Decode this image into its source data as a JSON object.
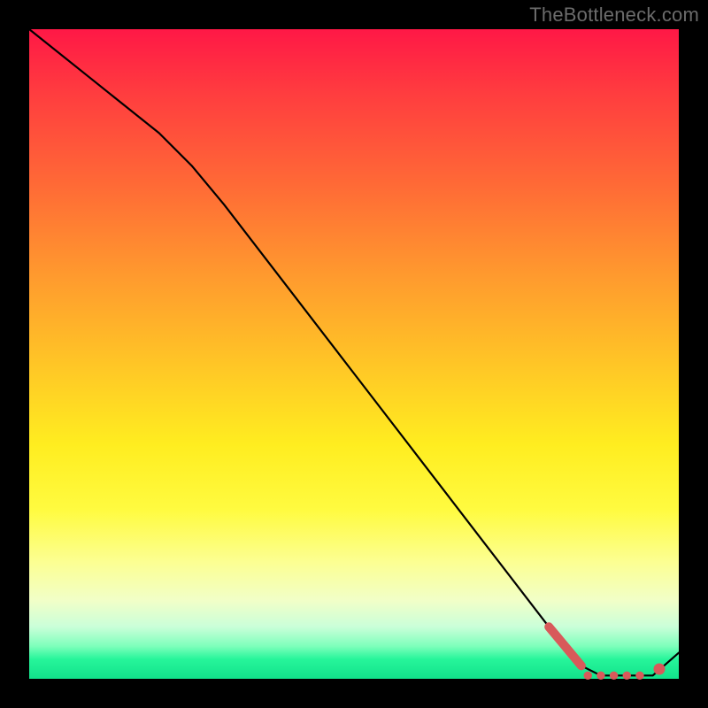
{
  "watermark": "TheBottleneck.com",
  "chart_data": {
    "type": "line",
    "title": "",
    "xlabel": "",
    "ylabel": "",
    "xlim": [
      0,
      100
    ],
    "ylim": [
      0,
      100
    ],
    "grid": false,
    "series": [
      {
        "name": "bottleneck-curve",
        "x": [
          0,
          10,
          20,
          25,
          30,
          40,
          50,
          60,
          70,
          80,
          85,
          88,
          92,
          96,
          100
        ],
        "y": [
          100,
          92,
          84,
          79,
          73,
          60,
          47,
          34,
          21,
          8,
          2,
          0.5,
          0.5,
          0.5,
          4
        ]
      }
    ],
    "markers": [
      {
        "name": "highlight-segment-start",
        "x": 80,
        "y": 8
      },
      {
        "name": "highlight-segment-end",
        "x": 85,
        "y": 2
      },
      {
        "name": "flat-dot-1",
        "x": 86,
        "y": 0.5
      },
      {
        "name": "flat-dot-2",
        "x": 88,
        "y": 0.5
      },
      {
        "name": "flat-dot-3",
        "x": 90,
        "y": 0.5
      },
      {
        "name": "flat-dot-4",
        "x": 92,
        "y": 0.5
      },
      {
        "name": "flat-dot-5",
        "x": 94,
        "y": 0.5
      },
      {
        "name": "end-dot",
        "x": 97,
        "y": 1.5
      }
    ],
    "colors": {
      "curve": "#000000",
      "markers": "#d85a5a",
      "gradient_top": "#ff1846",
      "gradient_bottom": "#12e28b"
    }
  }
}
